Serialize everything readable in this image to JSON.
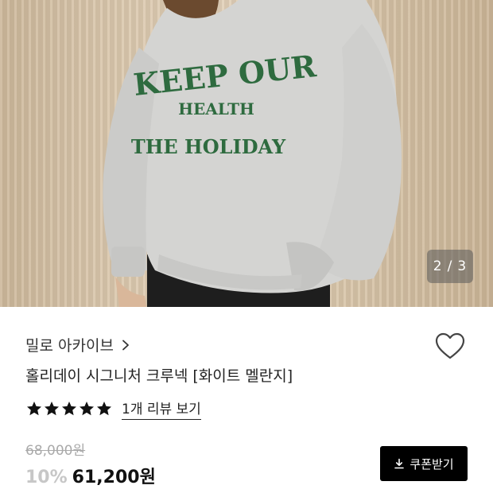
{
  "gallery": {
    "pager_current": "2",
    "pager_sep": "/",
    "pager_total": "3",
    "shirt_print_line1": "KEEP OUR",
    "shirt_print_line2": "HEALTH",
    "shirt_print_line3": "THE HOLIDAY"
  },
  "product": {
    "brand": "밀로 아카이브",
    "title": "홀리데이 시그니처 크루넥 [화이트 멜란지]",
    "rating": 5,
    "review_link": "1개 리뷰 보기",
    "original_price": "68,000원",
    "discount": "10%",
    "sale_price": "61,200원",
    "coupon_label": "쿠폰받기"
  },
  "icons": {
    "brand_arrow": "chevron-right-icon",
    "wishlist": "heart-outline-icon",
    "coupon": "download-icon",
    "star": "star-icon"
  },
  "colors": {
    "star": "#111111",
    "coupon_bg": "#000000",
    "discount": "#c7c7c7",
    "shirt_print": "#2e6b3f"
  }
}
